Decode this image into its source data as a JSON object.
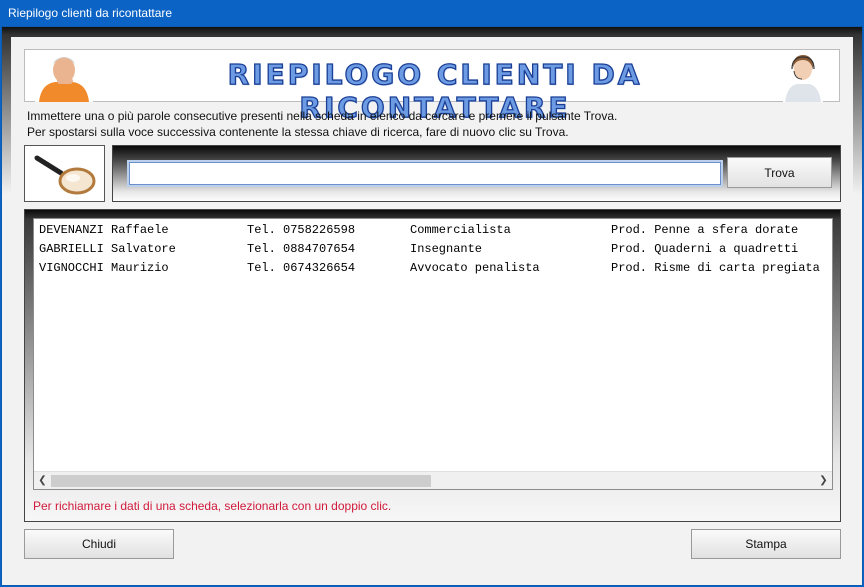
{
  "window": {
    "title": "Riepilogo clienti da ricontattare"
  },
  "banner": {
    "title": "RIEPILOGO CLIENTI DA RICONTATTARE"
  },
  "instructions": {
    "line1": "Immettere una o più parole consecutive presenti nella scheda in elenco da cercare e premere il pulsante Trova.",
    "line2": "Per spostarsi sulla voce successiva contenente la stessa chiave di ricerca, fare di nuovo clic su Trova."
  },
  "search": {
    "value": "",
    "button_label": "Trova",
    "icon": "magnifier-icon"
  },
  "list": {
    "rows": [
      {
        "name": "DEVENANZI Raffaele",
        "phone": "Tel. 0758226598",
        "job": "Commercialista",
        "product": "Prod. Penne a sfera dorate"
      },
      {
        "name": "GABRIELLI Salvatore",
        "phone": "Tel. 0884707654",
        "job": "Insegnante",
        "product": "Prod. Quaderni a quadretti"
      },
      {
        "name": "VIGNOCCHI Maurizio",
        "phone": "Tel. 0674326654",
        "job": "Avvocato penalista",
        "product": "Prod. Risme di carta pregiata"
      }
    ]
  },
  "hint": "Per richiamare i dati di una scheda, selezionarla con un doppio clic.",
  "buttons": {
    "close": "Chiudi",
    "print": "Stampa"
  },
  "colors": {
    "titlebar": "#0b63c5",
    "banner_text": "#6d9be3",
    "hint": "#d11a3b"
  }
}
